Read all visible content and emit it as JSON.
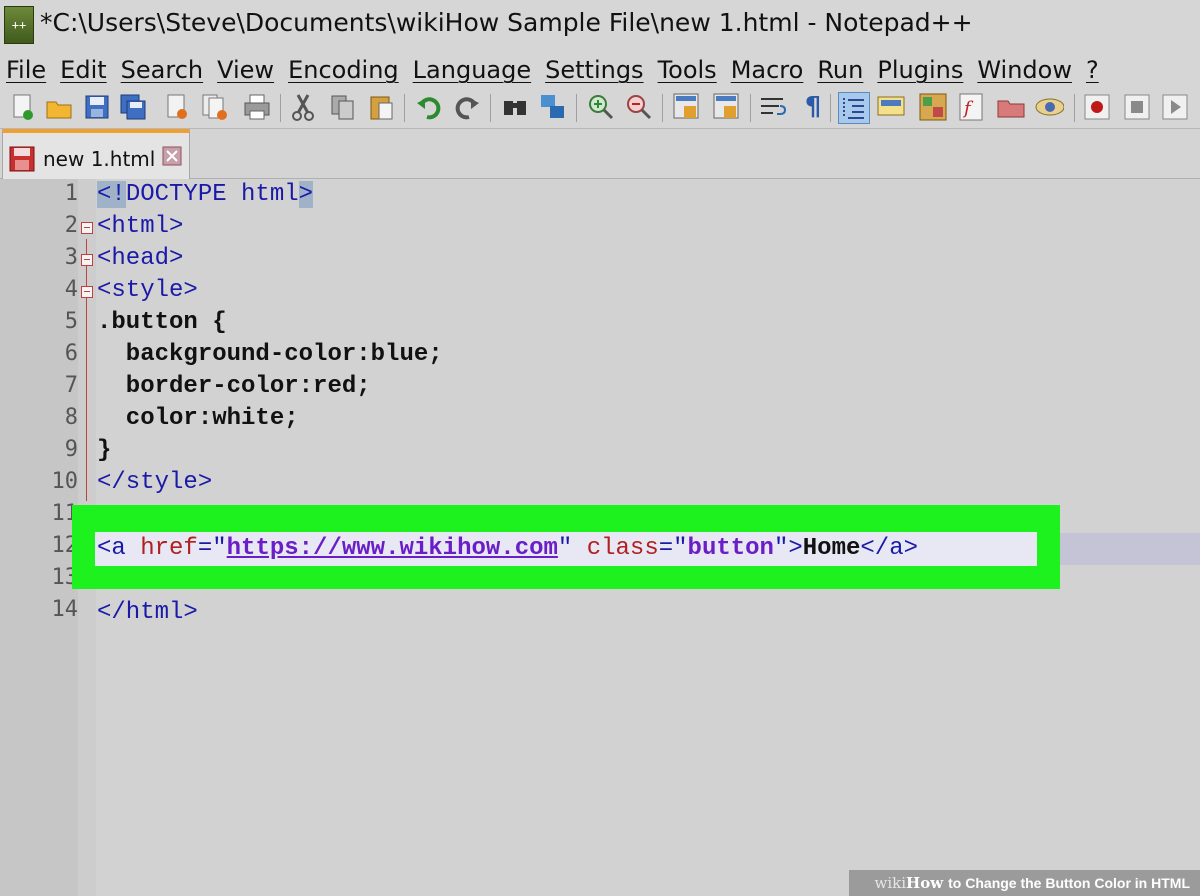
{
  "window": {
    "title": "*C:\\Users\\Steve\\Documents\\wikiHow Sample File\\new 1.html - Notepad++",
    "app_icon": "notepad-plus-plus-icon"
  },
  "menu": [
    {
      "label": "File"
    },
    {
      "label": "Edit"
    },
    {
      "label": "Search"
    },
    {
      "label": "View"
    },
    {
      "label": "Encoding"
    },
    {
      "label": "Language"
    },
    {
      "label": "Settings"
    },
    {
      "label": "Tools"
    },
    {
      "label": "Macro"
    },
    {
      "label": "Run"
    },
    {
      "label": "Plugins"
    },
    {
      "label": "Window"
    },
    {
      "label": "?"
    }
  ],
  "toolbar": [
    "new-file-icon",
    "open-file-icon",
    "save-icon",
    "save-all-icon",
    "close-icon",
    "close-all-icon",
    "print-icon",
    "cut-icon",
    "copy-icon",
    "paste-icon",
    "undo-icon",
    "redo-icon",
    "find-icon",
    "replace-icon",
    "zoom-in-icon",
    "zoom-out-icon",
    "sync-vertical-icon",
    "sync-horizontal-icon",
    "word-wrap-icon",
    "show-all-characters-icon",
    "indent-guide-icon",
    "udl-icon",
    "doc-map-icon",
    "function-list-icon",
    "folder-workspace-icon",
    "monitoring-icon",
    "record-macro-icon",
    "stop-recording-icon",
    "play-macro-icon"
  ],
  "tab": {
    "label": "new 1.html",
    "icon": "unsaved-file-icon"
  },
  "line_numbers": [
    "1",
    "2",
    "3",
    "4",
    "5",
    "6",
    "7",
    "8",
    "9",
    "10",
    "11",
    "12",
    "13",
    "14"
  ],
  "code": {
    "l1_open": "<!",
    "l1_mid": "DOCTYPE html",
    "l1_close": ">",
    "l2": "<html>",
    "l3": "<head>",
    "l4": "<style>",
    "l5": ".button {",
    "l6": "  background-color:blue;",
    "l7": "  border-color:red;",
    "l8": "  color:white;",
    "l9": "}",
    "l10": "</style>",
    "l12": {
      "open": "<a ",
      "href_attr": "href",
      "eq1": "=\"",
      "url": "https://www.wikihow.com",
      "q1": "\" ",
      "class_attr": "class",
      "eq2": "=\"",
      "class_val": "button",
      "q2": "\">",
      "text": "Home",
      "close": "</a>"
    },
    "l14": "</html>"
  },
  "watermark": {
    "wiki": "wiki",
    "how": "How",
    "rest": "to Change the Button Color in HTML"
  },
  "colors": {
    "highlight": "#1ef21e",
    "tag": "#1a1aa8",
    "attr": "#b02020",
    "string": "#6a1ec8"
  }
}
